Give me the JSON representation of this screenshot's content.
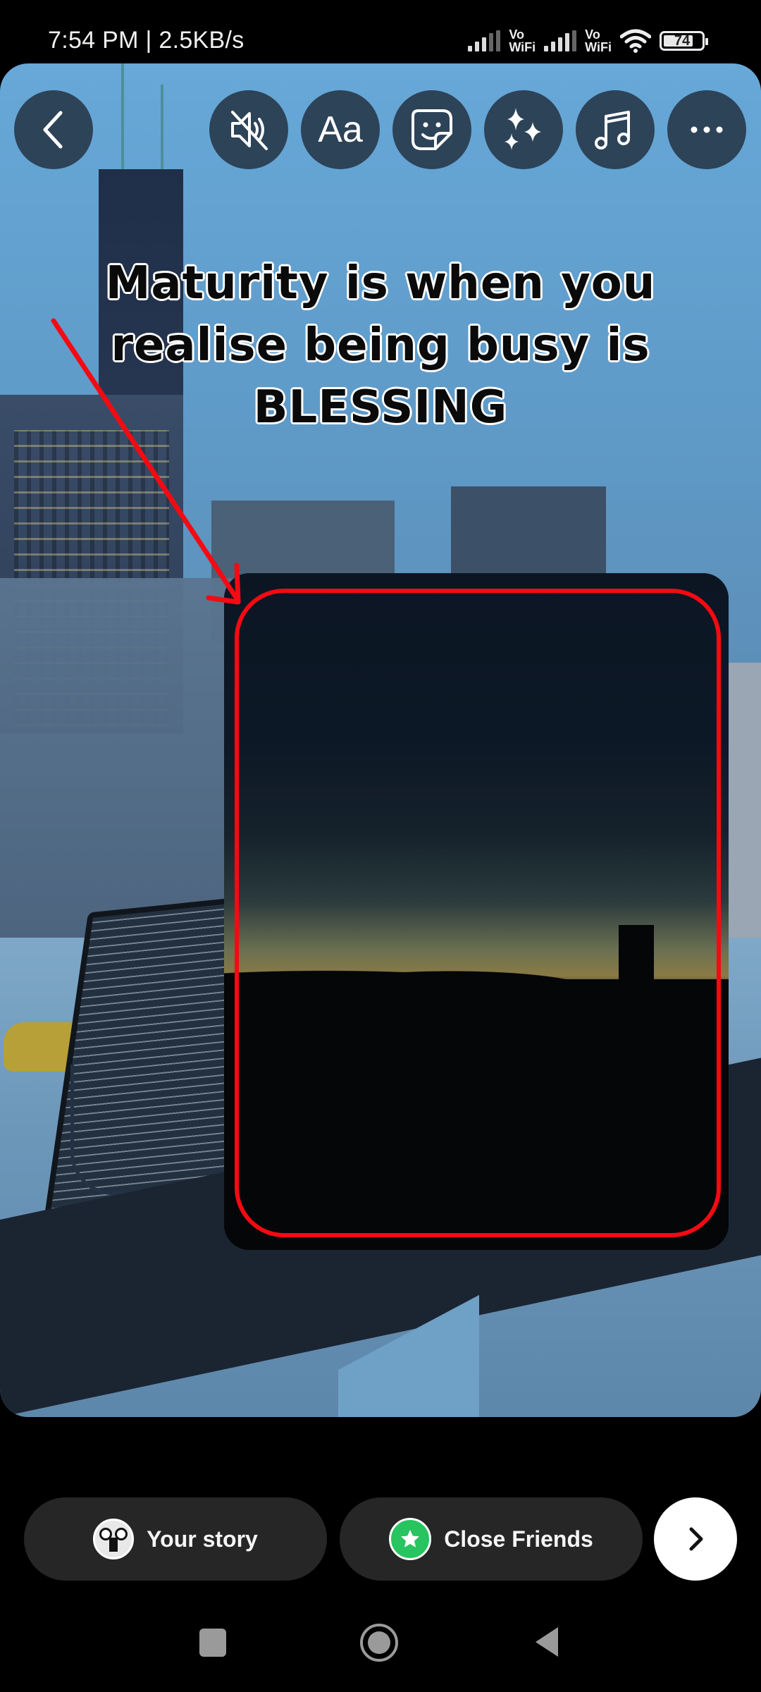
{
  "status_bar": {
    "time": "7:54 PM",
    "separator": "|",
    "network_speed": "2.5KB/s",
    "sim1_label_top": "Vo",
    "sim1_label_bottom": "WiFi",
    "sim2_label_top": "Vo",
    "sim2_label_bottom": "WiFi",
    "battery_level": "74",
    "icons": [
      "signal-icon",
      "signal-icon",
      "wifi-icon",
      "battery-icon"
    ]
  },
  "editor_toolbar": {
    "back": {
      "icon": "chevron-left-icon"
    },
    "tools": [
      {
        "name": "mute",
        "icon": "speaker-muted-icon"
      },
      {
        "name": "text",
        "icon": "text-icon",
        "label": "Aa"
      },
      {
        "name": "stickers",
        "icon": "sticker-icon"
      },
      {
        "name": "effects",
        "icon": "sparkles-icon"
      },
      {
        "name": "music",
        "icon": "music-note-icon"
      },
      {
        "name": "more",
        "icon": "more-horizontal-icon"
      }
    ]
  },
  "story": {
    "quote_lines": [
      "Maturity is when you",
      "realise being busy is",
      "BLESSING"
    ],
    "annotation": {
      "color": "#f40a12",
      "type": "arrow-and-rounded-frame"
    },
    "sticker_type": "photo"
  },
  "share_bar": {
    "your_story_label": "Your story",
    "close_friends_label": "Close Friends",
    "close_friends_color": "#27c460",
    "next_icon": "chevron-right-icon"
  },
  "nav_bar": {
    "buttons": [
      "recents",
      "home",
      "back"
    ]
  }
}
